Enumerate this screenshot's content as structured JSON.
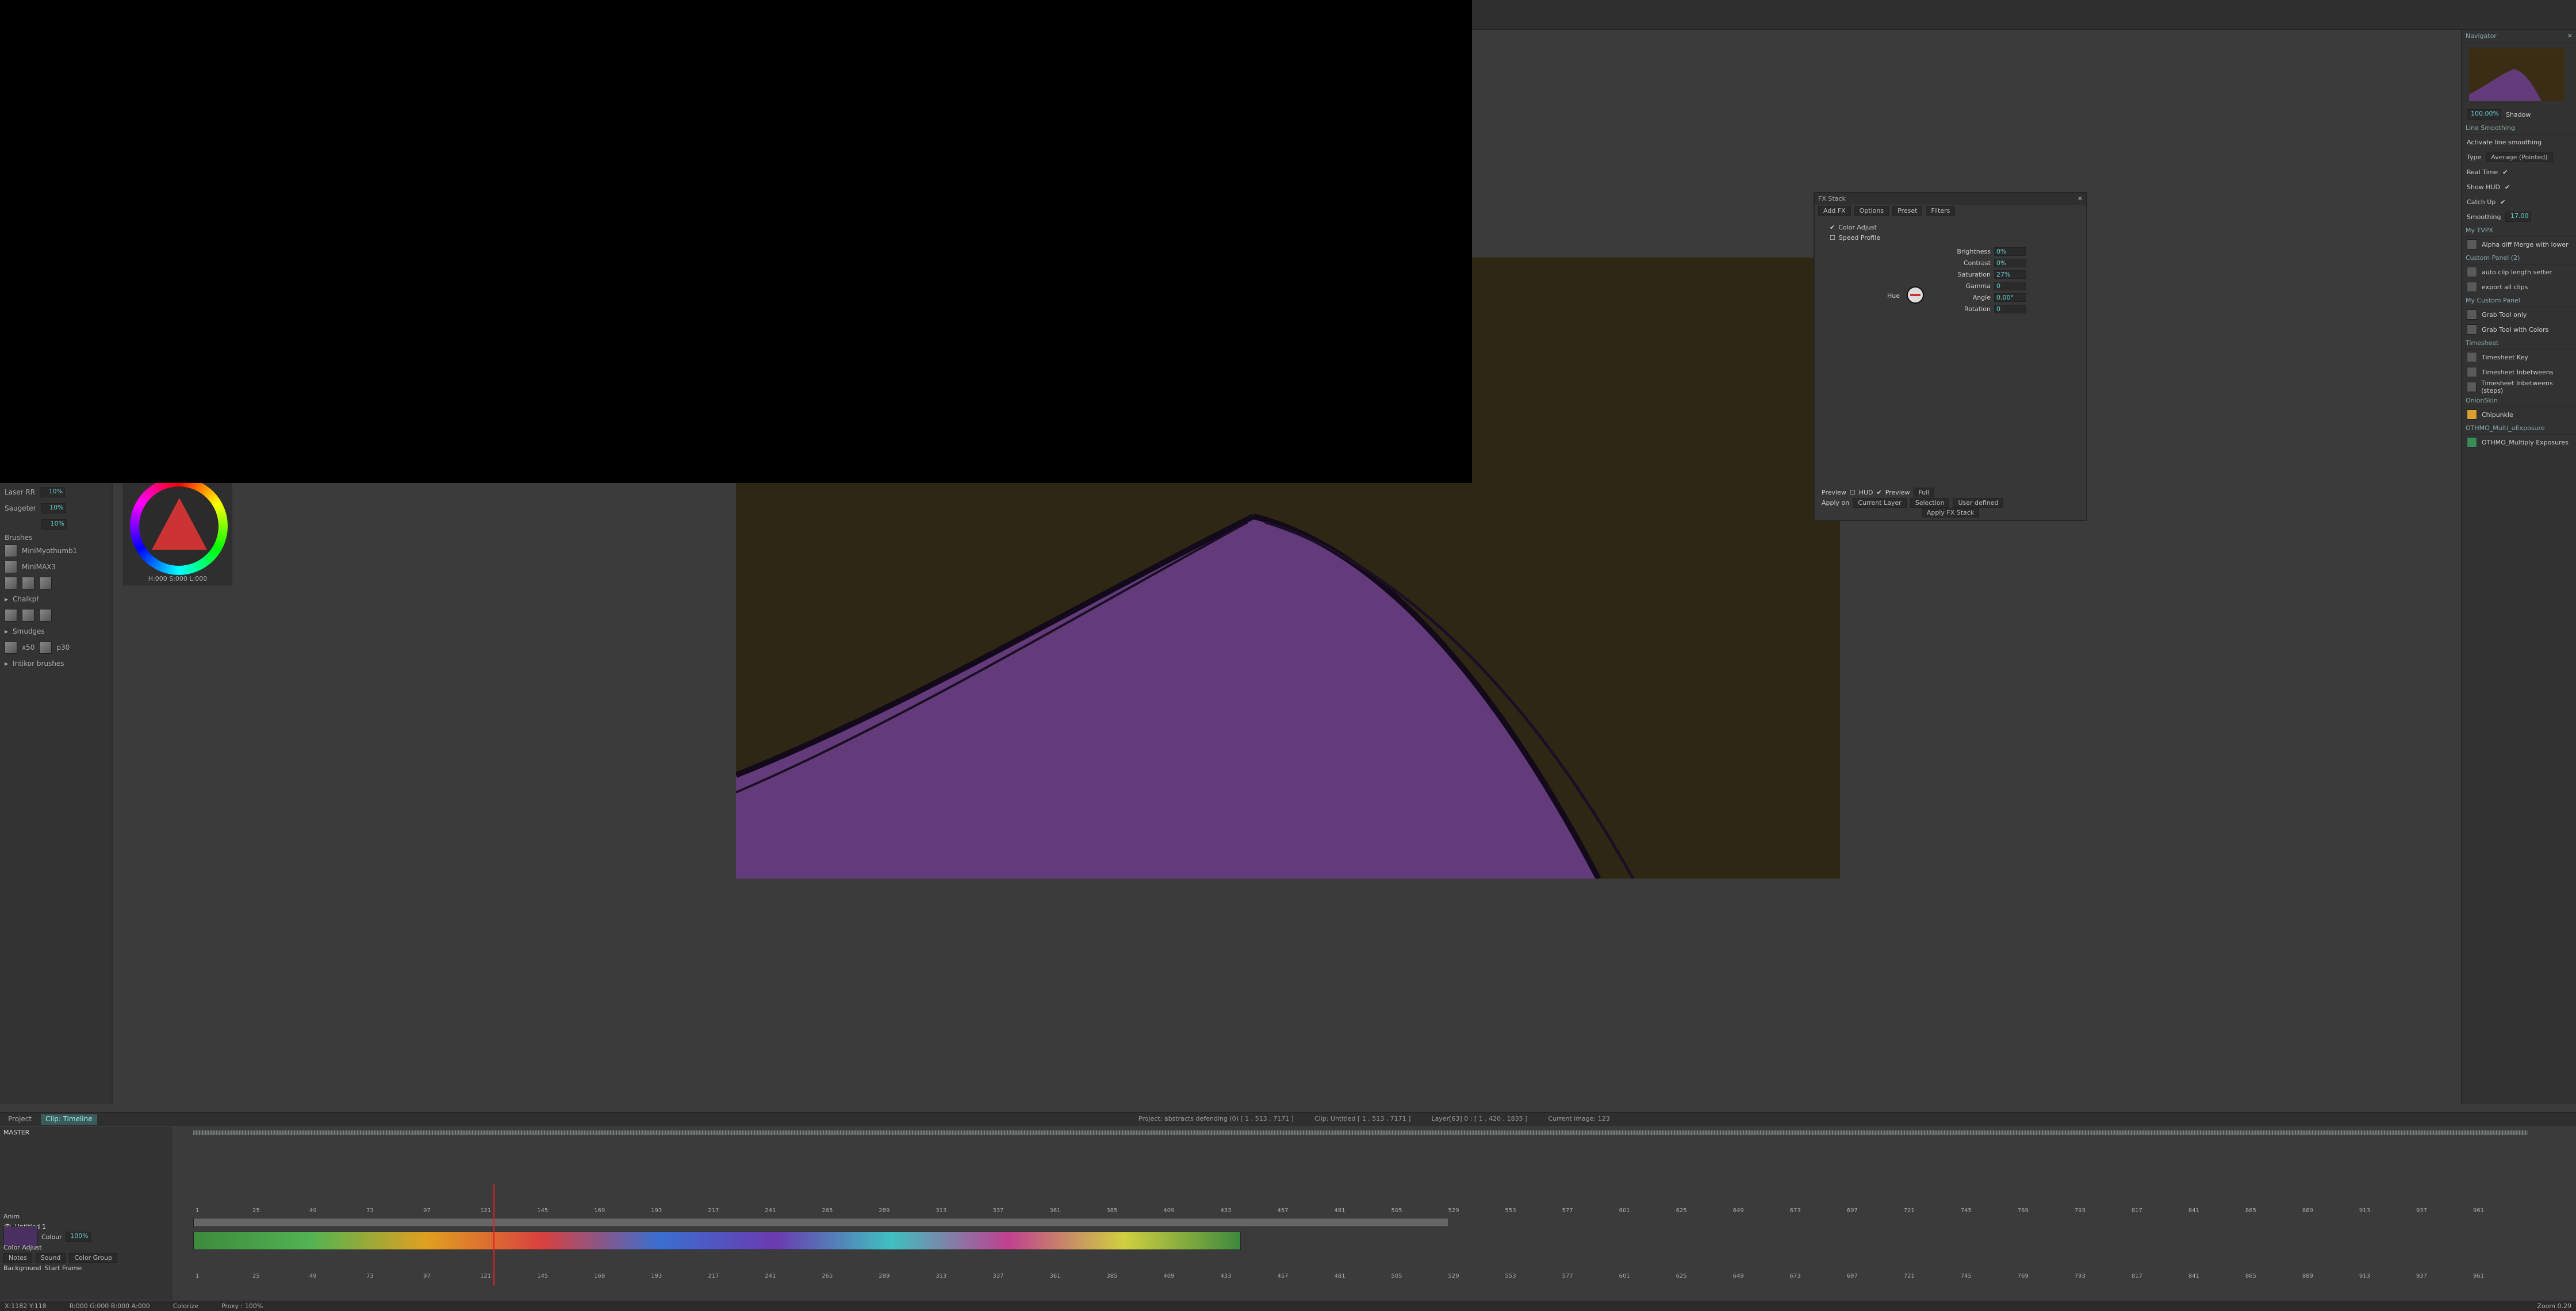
{
  "left_panel": {
    "laser_label": "Laser RR",
    "laser_value": "10%",
    "saugeter_label": "Saugeter",
    "saugeter_value": "10%",
    "third_value": "10%",
    "brushes_title": "Brushes",
    "brush_items": [
      "MiniMyothumb1",
      "MiniMAX3"
    ],
    "folder_1": "Chalkp!",
    "folder_2": "Smudges",
    "folder_3_label": "x50",
    "folder_3_value": "p30",
    "folder_4": "Intikor brushes",
    "color_readout": "H:000 S:000 L:000"
  },
  "fx_stack": {
    "title": "FX Stack",
    "add_fx": "Add FX",
    "options": "Options",
    "preset": "Preset",
    "filters": "Filters",
    "effects": [
      "Color Adjust",
      "Speed Profile"
    ],
    "params": [
      {
        "name": "Brightness",
        "value": "0%"
      },
      {
        "name": "Contrast",
        "value": "0%"
      },
      {
        "name": "Saturation",
        "value": "27%"
      },
      {
        "name": "Gamma",
        "value": "0"
      },
      {
        "name": "Angle",
        "value": "0.00°"
      },
      {
        "name": "Rotation",
        "value": "0"
      }
    ],
    "hue_label": "Hue",
    "preview_label": "Preview",
    "hud_label": "HUD",
    "preview_mode_label": "Preview",
    "preview_mode_value": "Full",
    "apply_on_label": "Apply on",
    "apply_on_value": "Current Layer",
    "selection_label": "Selection",
    "user_defined": "User defined",
    "apply_button": "Apply FX Stack"
  },
  "right_panel": {
    "navigator_title": "Navigator",
    "zoom_value": "100.00%",
    "shadow_label": "Shadow",
    "line_smoothing_title": "Line Smoothing",
    "activate_label": "Activate line smoothing",
    "type_label": "Type",
    "type_value": "Average (Pointed)",
    "realtime_label": "Real Time",
    "show_hud_label": "Show HUD",
    "catch_up_label": "Catch Up",
    "smoothing_label": "Smoothing",
    "smoothing_value": "17.00",
    "my_tvpx_title": "My TVPX",
    "my_tvpx_item": "Alpha diff Merge with lower",
    "custom_panel_title": "Custom Panel (2)",
    "custom_items": [
      "auto clip length setter",
      "export all clips"
    ],
    "my_custom_panel_title": "My Custom Panel",
    "my_custom_items": [
      "Grab Tool only",
      "Grab Tool with Colors"
    ],
    "timesheet_title": "Timesheet",
    "timesheet_items": [
      "Timesheet Key",
      "Timesheet Inbetweens",
      "Timesheet Inbetweens (steps)"
    ],
    "onionskin_title": "OnionSkin",
    "onionskin_item": "Chipunkle",
    "multi_title": "OTHMO_Multi_uExposure",
    "multi_item": "OTHMO_Multiply Exposures"
  },
  "timeline": {
    "tab_project": "Project",
    "tab_clip": "Clip: Timeline",
    "info_project": "Project: abstracts defending (0) [ 1 , 513 , 7171 ]",
    "info_clip": "Clip: Untitled [ 1 , 513 , 7171 ]",
    "info_layer": "Layer[63] 0 : [ 1 , 420 , 1835 ]",
    "info_current": "Current image: 123",
    "master_label": "MASTER",
    "layer_header": "Anim",
    "layer_name": "Untitled 1",
    "layer_fx": "Color Adjust",
    "color_label": "Colour",
    "opacity_value": "100%",
    "buttons": [
      "Notes",
      "Sound",
      "Color Group"
    ],
    "background_label": "Background",
    "start_frame_label": "Start Frame",
    "ruler_ticks": [
      "1",
      "25",
      "49",
      "73",
      "97",
      "121",
      "145",
      "169",
      "193",
      "217",
      "241",
      "265",
      "289",
      "313",
      "337",
      "361",
      "385",
      "409",
      "433",
      "457",
      "481",
      "505",
      "529",
      "553",
      "577",
      "601",
      "625",
      "649",
      "673",
      "697",
      "721",
      "745",
      "769",
      "793",
      "817",
      "841",
      "865",
      "889",
      "913",
      "937",
      "961"
    ]
  },
  "statusbar": {
    "coords": "X:1182  Y:118",
    "rgba": "R:000 G:000 B:000 A:000",
    "colorize": "Colorize",
    "proxy": "Proxy : 100%",
    "zoom": "Zoom 0.29"
  },
  "colors": {
    "stage_bg": "#2d2713",
    "shape_fill": "#633b7a",
    "accent": "#44aaaa"
  }
}
